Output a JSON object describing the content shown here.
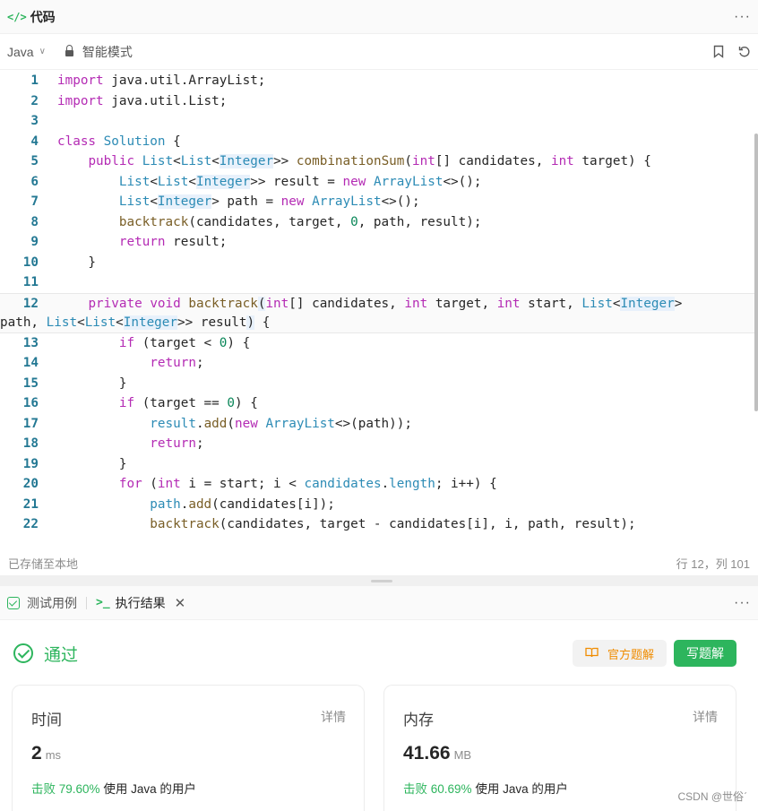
{
  "header": {
    "title": "代码",
    "code_icon": "</>"
  },
  "toolbar": {
    "language": "Java",
    "mode": "智能模式"
  },
  "editor": {
    "line_numbers": [
      "1",
      "2",
      "3",
      "4",
      "5",
      "6",
      "7",
      "8",
      "9",
      "10",
      "11",
      "12",
      "13",
      "14",
      "15",
      "16",
      "17",
      "18",
      "19",
      "20",
      "21",
      "22"
    ]
  },
  "status": {
    "saved": "已存储至本地",
    "position": "行 12，列 101"
  },
  "tabs": {
    "testcase": "测试用例",
    "result": "执行结果"
  },
  "result": {
    "status": "通过",
    "solution_button": "官方题解",
    "write_button": "写题解",
    "time": {
      "label": "时间",
      "detail": "详情",
      "value": "2",
      "unit": "ms",
      "beat_prefix": "击败",
      "beat_pct": "79.60%",
      "beat_suffix": "使用 Java 的用户"
    },
    "memory": {
      "label": "内存",
      "detail": "详情",
      "value": "41.66",
      "unit": "MB",
      "beat_prefix": "击败",
      "beat_pct": "60.69%",
      "beat_suffix": "使用 Java 的用户"
    }
  },
  "watermark": "CSDN @世俗ˊ",
  "colors": {
    "accent": "#2db55d",
    "orange": "#f08c00",
    "keyword": "#b42bb4",
    "type": "#2c8bb5",
    "line_number": "#237893"
  }
}
